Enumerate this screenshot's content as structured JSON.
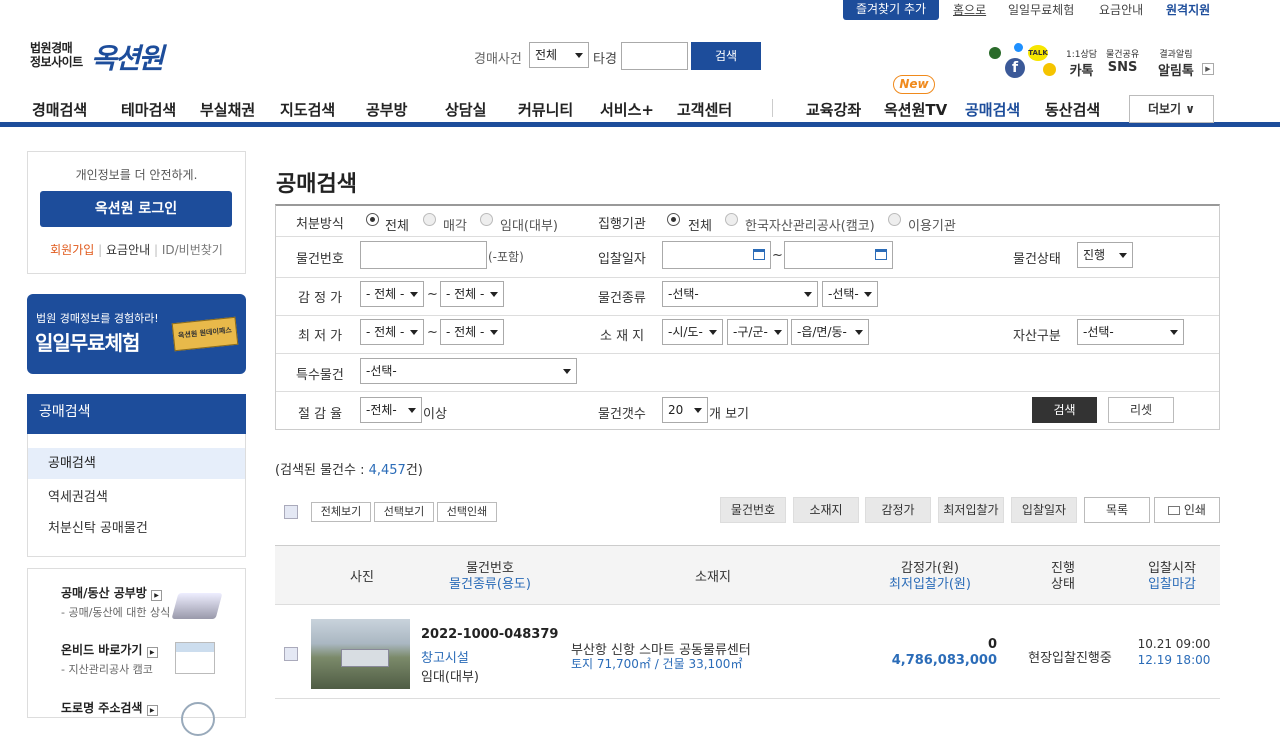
{
  "topbar": {
    "favorite": "즐겨찾기 추가",
    "home": "홈으로",
    "free_trial": "일일무료체험",
    "pricing": "요금안내",
    "remote": "원격지원"
  },
  "logo": {
    "line1": "법원경매",
    "line2": "정보사이트",
    "brand": "옥션원"
  },
  "header_search": {
    "label": "경매사건",
    "select_value": "전체",
    "case_label": "타경",
    "button": "검색"
  },
  "social": {
    "counsel_label": "1:1상담",
    "kakao": "카톡",
    "share_label": "물건공유",
    "sns": "SNS",
    "alert_label": "결과알림",
    "alimtalk": "알림톡"
  },
  "gnb": {
    "items": [
      "경매검색",
      "테마검색",
      "부실채권",
      "지도검색",
      "공부방",
      "상담실",
      "커뮤니티",
      "서비스+",
      "고객센터",
      "교육강좌",
      "옥션원TV",
      "공매검색",
      "동산검색"
    ],
    "new_badge": "New",
    "more": "더보기 ∨"
  },
  "login_box": {
    "notice": "개인정보를 더 안전하게.",
    "login_button": "옥션원 로그인",
    "join": "회원가입",
    "pricing": "요금안내",
    "find": "ID/비번찾기"
  },
  "promo": {
    "line1": "법원 경매정보를 경험하라!",
    "line2": "일일무료체험",
    "ticket": "옥션원 원데이패스"
  },
  "side_menu": {
    "title": "공매검색",
    "items": [
      "공매검색",
      "역세권검색",
      "처분신탁 공매물건"
    ]
  },
  "side_links": [
    {
      "title": "공매/동산 공부방",
      "desc": "- 공매/동산에 대한 상식"
    },
    {
      "title": "온비드 바로가기",
      "desc": "- 지산관리공사 캠코"
    },
    {
      "title": "도로명 주소검색",
      "desc": ""
    }
  ],
  "page_title": "공매검색",
  "form": {
    "disposal_label": "처분방식",
    "disposal_options": [
      "전체",
      "매각",
      "임대(대부)"
    ],
    "agency_label": "집행기관",
    "agency_options": [
      "전체",
      "한국자산관리공사(캠코)",
      "이용기관"
    ],
    "item_no_label": "물건번호",
    "item_no_hint": "(-포함)",
    "bid_date_label": "입찰일자",
    "tilde": "~",
    "status_label": "물건상태",
    "status_value": "진행",
    "appraisal_label": "감 정 가",
    "all_select": "- 전체 -",
    "type_label": "물건종류",
    "select_default": "-선택-",
    "min_label": "최 저 가",
    "location_label": "소 재 지",
    "sido": "-시/도-",
    "gugun": "-구/군-",
    "dong": "-읍/면/동-",
    "asset_label": "자산구분",
    "special_label": "특수물건",
    "reduction_label": "절 감 율",
    "reduction_value": "-전체-",
    "reduction_suffix": "이상",
    "count_label": "물건갯수",
    "count_value": "20",
    "count_suffix": "개 보기",
    "search_button": "검색",
    "reset_button": "리셋"
  },
  "result": {
    "prefix": "(검색된 물건수 : ",
    "count": "4,457",
    "suffix": "건)"
  },
  "toolbar": {
    "view_all": "전체보기",
    "view_selected": "선택보기",
    "print_selected": "선택인쇄",
    "sort": [
      "물건번호",
      "소재지",
      "감정가",
      "최저입찰가",
      "입찰일자"
    ],
    "list": "목록",
    "print": "인쇄"
  },
  "table": {
    "headers": {
      "photo": "사진",
      "item_no": "물건번호",
      "item_type": "물건종류(용도)",
      "location": "소재지",
      "appraisal": "감정가(원)",
      "min_bid": "최저입찰가(원)",
      "status1": "진행",
      "status2": "상태",
      "bid_start": "입찰시작",
      "bid_end": "입찰마감"
    },
    "rows": [
      {
        "item_no": "2022-1000-048379",
        "type": "창고시설",
        "usage": "임대(대부)",
        "address": "부산항 신항 스마트 공동물류센터",
        "area": "토지 71,700㎡ / 건물 33,100㎡",
        "appraisal": "0",
        "min_bid": "4,786,083,000",
        "status": "현장입찰진행중",
        "start": "10.21 09:00",
        "end": "12.19 18:00"
      }
    ]
  },
  "colors": {
    "brand": "#1d4d9b",
    "accent": "#2b6cb8",
    "join": "#e05a1c",
    "new_badge": "#f08a1c"
  }
}
